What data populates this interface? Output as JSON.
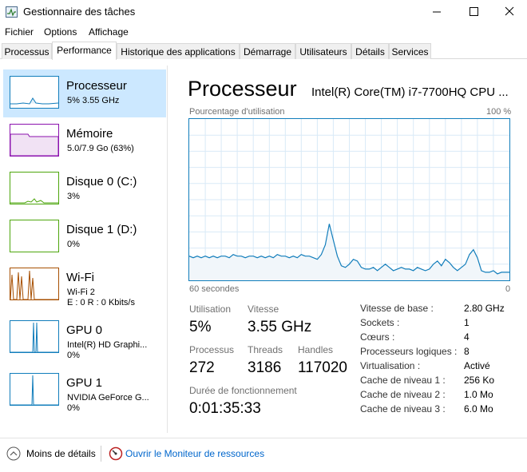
{
  "window": {
    "title": "Gestionnaire des tâches"
  },
  "menu": [
    "Fichier",
    "Options",
    "Affichage"
  ],
  "tabs": [
    "Processus",
    "Performance",
    "Historique des applications",
    "Démarrage",
    "Utilisateurs",
    "Détails",
    "Services"
  ],
  "sidebar": [
    {
      "name": "Processeur",
      "sub": "5% 3.55 GHz",
      "sub2": ""
    },
    {
      "name": "Mémoire",
      "sub": "5.0/7.9 Go (63%)",
      "sub2": ""
    },
    {
      "name": "Disque 0 (C:)",
      "sub": "3%",
      "sub2": ""
    },
    {
      "name": "Disque 1 (D:)",
      "sub": "0%",
      "sub2": ""
    },
    {
      "name": "Wi-Fi",
      "sub": "Wi-Fi 2",
      "sub2": "E : 0 R : 0 Kbits/s"
    },
    {
      "name": "GPU 0",
      "sub": "Intel(R) HD Graphi...",
      "sub2": "0%"
    },
    {
      "name": "GPU 1",
      "sub": "NVIDIA GeForce G...",
      "sub2": "0%"
    }
  ],
  "main": {
    "title": "Processeur",
    "model": "Intel(R) Core(TM) i7-7700HQ CPU ...",
    "chart_top_left": "Pourcentage d'utilisation",
    "chart_top_right": "100 %",
    "chart_bottom_left": "60 secondes",
    "chart_bottom_right": "0"
  },
  "stats": {
    "utilisation_label": "Utilisation",
    "utilisation_value": "5%",
    "vitesse_label": "Vitesse",
    "vitesse_value": "3.55 GHz",
    "processus_label": "Processus",
    "processus_value": "272",
    "threads_label": "Threads",
    "threads_value": "3186",
    "handles_label": "Handles",
    "handles_value": "117020",
    "duree_label": "Durée de fonctionnement",
    "duree_value": "0:01:35:33"
  },
  "info": [
    {
      "key": "Vitesse de base :",
      "value": "2.80 GHz"
    },
    {
      "key": "Sockets :",
      "value": "1"
    },
    {
      "key": "Cœurs :",
      "value": "4"
    },
    {
      "key": "Processeurs logiques :",
      "value": "8"
    },
    {
      "key": "Virtualisation :",
      "value": "Activé"
    },
    {
      "key": "Cache de niveau 1 :",
      "value": "256 Ko"
    },
    {
      "key": "Cache de niveau 2 :",
      "value": "1.0 Mo"
    },
    {
      "key": "Cache de niveau 3 :",
      "value": "6.0 Mo"
    }
  ],
  "footer": {
    "less_details": "Moins de détails",
    "resource_monitor": "Ouvrir le Moniteur de ressources"
  },
  "chart_data": {
    "type": "area",
    "ylim": [
      0,
      100
    ],
    "color": "#117dbb",
    "values": [
      15,
      14,
      15,
      14,
      15,
      14,
      15,
      14,
      15,
      15,
      14,
      16,
      15,
      15,
      14,
      15,
      15,
      14,
      15,
      14,
      15,
      14,
      16,
      15,
      15,
      14,
      15,
      14,
      16,
      15,
      15,
      14,
      13,
      16,
      22,
      35,
      25,
      15,
      9,
      8,
      10,
      13,
      12,
      8,
      7,
      7,
      8,
      6,
      8,
      10,
      8,
      6,
      7,
      8,
      7,
      7,
      6,
      8,
      7,
      6,
      7,
      10,
      12,
      9,
      13,
      11,
      8,
      6,
      8,
      10,
      16,
      19,
      14,
      6,
      5,
      5,
      6,
      4,
      5,
      5,
      5
    ]
  },
  "colors": {
    "accent": "#117dbb",
    "memory": "#8b12ae",
    "disk": "#4da60c",
    "wifi": "#a74f01",
    "selected": "#cce8ff"
  }
}
